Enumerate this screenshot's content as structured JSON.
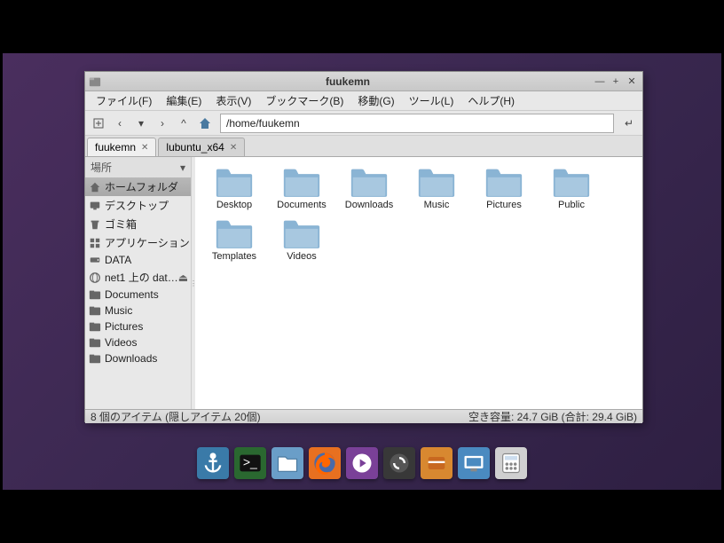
{
  "window": {
    "title": "fuukemn",
    "menus": [
      "ファイル(F)",
      "編集(E)",
      "表示(V)",
      "ブックマーク(B)",
      "移動(G)",
      "ツール(L)",
      "ヘルプ(H)"
    ],
    "address": "/home/fuukemn",
    "tabs": [
      {
        "label": "fuukemn",
        "active": true
      },
      {
        "label": "lubuntu_x64",
        "active": false
      }
    ]
  },
  "sidebar": {
    "header": "場所",
    "places": [
      {
        "label": "ホームフォルダ",
        "icon": "home",
        "selected": true
      },
      {
        "label": "デスクトップ",
        "icon": "desktop"
      },
      {
        "label": "ゴミ箱",
        "icon": "trash"
      },
      {
        "label": "アプリケーション",
        "icon": "apps"
      },
      {
        "label": "DATA",
        "icon": "disk"
      },
      {
        "label": "net1 上の dat…",
        "icon": "network",
        "eject": true
      }
    ],
    "bookmarks": [
      {
        "label": "Documents"
      },
      {
        "label": "Music"
      },
      {
        "label": "Pictures"
      },
      {
        "label": "Videos"
      },
      {
        "label": "Downloads"
      }
    ]
  },
  "folders": [
    "Desktop",
    "Documents",
    "Downloads",
    "Music",
    "Pictures",
    "Public",
    "Templates",
    "Videos"
  ],
  "statusbar": {
    "left": "8 個のアイテム (隠しアイテム 20個)",
    "right": "空き容量: 24.7 GiB (合計: 29.4 GiB)"
  },
  "dock": [
    {
      "name": "anchor",
      "bg": "#3a7aa8"
    },
    {
      "name": "terminal",
      "bg": "#2a6830"
    },
    {
      "name": "files",
      "bg": "#6a9ec8"
    },
    {
      "name": "firefox",
      "bg": "#e87020"
    },
    {
      "name": "media",
      "bg": "#7a4098"
    },
    {
      "name": "update",
      "bg": "#383838"
    },
    {
      "name": "software",
      "bg": "#d88830"
    },
    {
      "name": "display",
      "bg": "#4a8ac0"
    },
    {
      "name": "calc",
      "bg": "#d0d0d0"
    }
  ]
}
